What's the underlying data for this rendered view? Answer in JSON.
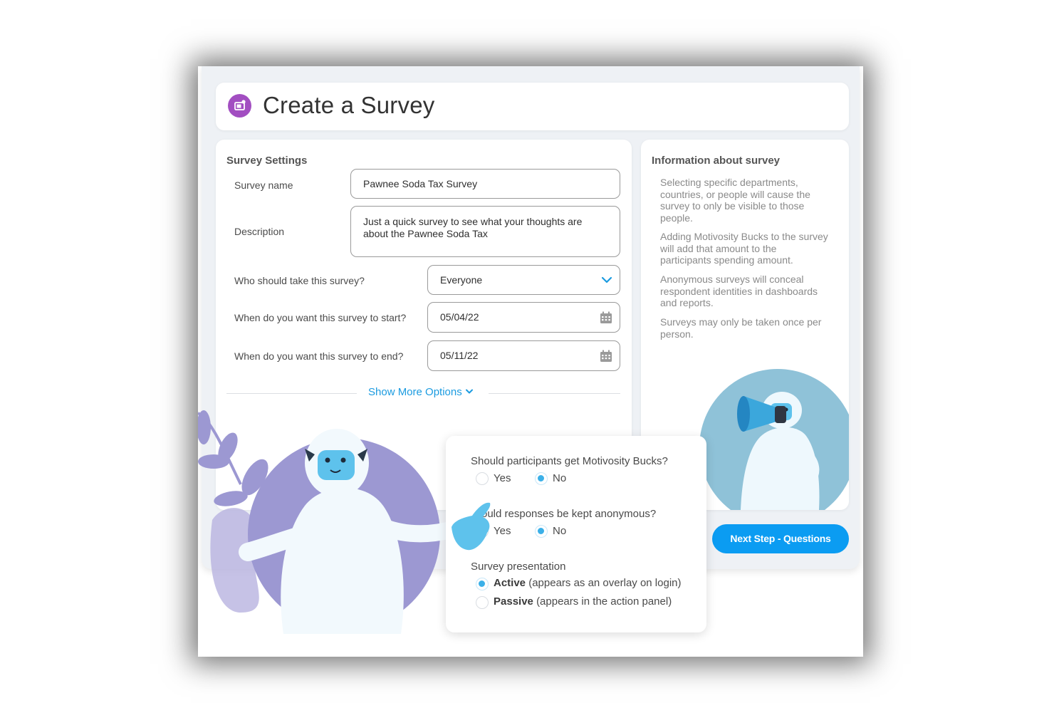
{
  "header": {
    "title": "Create a Survey",
    "icon": "survey-icon",
    "icon_color": "#a24ec1"
  },
  "settings": {
    "section_title": "Survey Settings",
    "survey_name": {
      "label": "Survey name",
      "value": "Pawnee Soda Tax Survey"
    },
    "description": {
      "label": "Description",
      "value_line1": "Just a quick survey to see what your thoughts are",
      "value_line2": "about the Pawnee Soda Tax"
    },
    "audience": {
      "label": "Who should take this survey?",
      "value": "Everyone",
      "icon": "chevron-down-icon"
    },
    "start": {
      "label": "When do you want this survey to start?",
      "value": "05/04/22",
      "icon": "calendar-icon"
    },
    "end": {
      "label": "When do you want this survey to end?",
      "value": "05/11/22",
      "icon": "calendar-icon"
    },
    "show_more": "Show More Options"
  },
  "info": {
    "title": "Information about survey",
    "paragraphs": [
      [
        "Selecting specific departments,",
        "countries, or people will cause the",
        "survey to only be visible to those",
        "people."
      ],
      [
        "Adding Motivosity Bucks to the survey",
        "will add that amount to the",
        "participants spending amount."
      ],
      [
        "Anonymous surveys will conceal",
        "respondent identities in dashboards",
        "and reports."
      ],
      [
        "Surveys may only be taken once per",
        "person."
      ]
    ]
  },
  "options": {
    "bucks": {
      "question": "Should participants get Motivosity Bucks?",
      "yes": "Yes",
      "no": "No",
      "selected": "No"
    },
    "anonymous": {
      "question": "ould responses be kept anonymous?",
      "yes": "Yes",
      "no": "No",
      "selected": "No"
    },
    "presentation": {
      "question": "Survey presentation",
      "active_bold": "Active",
      "active_rest": "(appears as an overlay on login)",
      "passive_bold": "Passive",
      "passive_rest": "(appears in the action panel)",
      "selected": "Active"
    }
  },
  "next_button": "Next Step - Questions",
  "colors": {
    "accent": "#0b9cf2",
    "link": "#1b9be0",
    "radio": "#3bb0e8",
    "yeti_face": "#5ec2ec",
    "circle_purple": "#9c98d2",
    "circle_blue": "#8fc2d8"
  }
}
